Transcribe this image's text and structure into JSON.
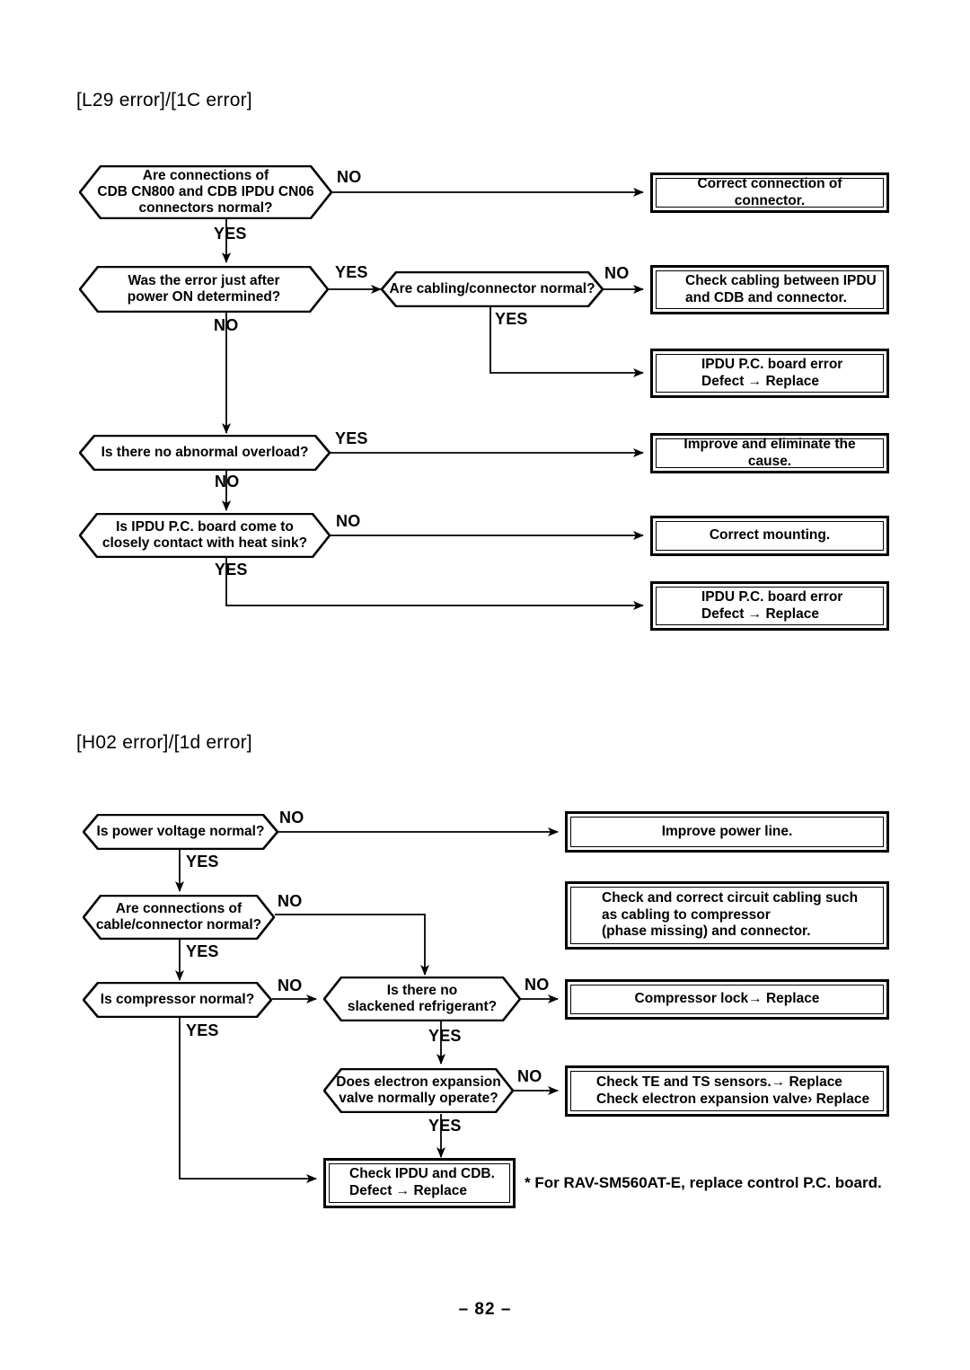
{
  "page": {
    "number_label": "– 82 –"
  },
  "sections": [
    {
      "id": "l29",
      "title": "[L29 error]/[1C error]",
      "decisions": [
        {
          "id": "d1",
          "text": "Are connections of\nCDB CN800 and CDB IPDU CN06\nconnectors normal?"
        },
        {
          "id": "d2",
          "text": "Was the error just after\npower ON determined?"
        },
        {
          "id": "d3",
          "text": "Are cabling/connector normal?"
        },
        {
          "id": "d4",
          "text": "Is there no abnormal overload?"
        },
        {
          "id": "d5",
          "text": "Is IPDU P.C. board come to\nclosely contact with heat sink?"
        }
      ],
      "actions": [
        {
          "id": "a1",
          "text": "Correct connection of connector."
        },
        {
          "id": "a2",
          "text": "Check cabling between IPDU\nand CDB and connector."
        },
        {
          "id": "a3",
          "text": "IPDU P.C. board error\nDefect → Replace"
        },
        {
          "id": "a4",
          "text": "Improve and eliminate the cause."
        },
        {
          "id": "a5",
          "text": "Correct mounting."
        },
        {
          "id": "a6",
          "text": "IPDU P.C. board error\nDefect → Replace"
        }
      ],
      "branch_labels": [
        {
          "id": "b1",
          "text": "NO"
        },
        {
          "id": "b2",
          "text": "YES"
        },
        {
          "id": "b3",
          "text": "YES"
        },
        {
          "id": "b4",
          "text": "NO"
        },
        {
          "id": "b5",
          "text": "NO"
        },
        {
          "id": "b6",
          "text": "YES"
        },
        {
          "id": "b7",
          "text": "YES"
        },
        {
          "id": "b8",
          "text": "NO"
        },
        {
          "id": "b9",
          "text": "NO"
        },
        {
          "id": "b10",
          "text": "YES"
        }
      ]
    },
    {
      "id": "h02",
      "title": "[H02 error]/[1d error]",
      "decisions": [
        {
          "id": "e1",
          "text": "Is power voltage normal?"
        },
        {
          "id": "e2",
          "text": "Are connections of\ncable/connector normal?"
        },
        {
          "id": "e3",
          "text": "Is compressor normal?"
        },
        {
          "id": "e4",
          "text": "Is there no\nslackened refrigerant?"
        },
        {
          "id": "e5",
          "text": "Does electron expansion\nvalve normally operate?"
        }
      ],
      "actions": [
        {
          "id": "c1",
          "text": "Improve power line."
        },
        {
          "id": "c2",
          "text": "Check and correct circuit cabling such\nas cabling to compressor\n(phase missing) and connector."
        },
        {
          "id": "c3",
          "text": "Compressor lock→ Replace"
        },
        {
          "id": "c4",
          "text": "Check TE and TS sensors.→ Replace\nCheck electron expansion valve› Replace"
        },
        {
          "id": "c5",
          "text": "Check IPDU and CDB.\nDefect → Replace"
        }
      ],
      "branch_labels": [
        {
          "id": "f1",
          "text": "NO"
        },
        {
          "id": "f2",
          "text": "YES"
        },
        {
          "id": "f3",
          "text": "NO"
        },
        {
          "id": "f4",
          "text": "YES"
        },
        {
          "id": "f5",
          "text": "NO"
        },
        {
          "id": "f6",
          "text": "NO"
        },
        {
          "id": "f7",
          "text": "YES"
        },
        {
          "id": "f8",
          "text": "YES"
        },
        {
          "id": "f9",
          "text": "NO"
        },
        {
          "id": "f10",
          "text": "YES"
        }
      ],
      "footnote": "* For RAV-SM560AT-E, replace control P.C. board."
    }
  ]
}
